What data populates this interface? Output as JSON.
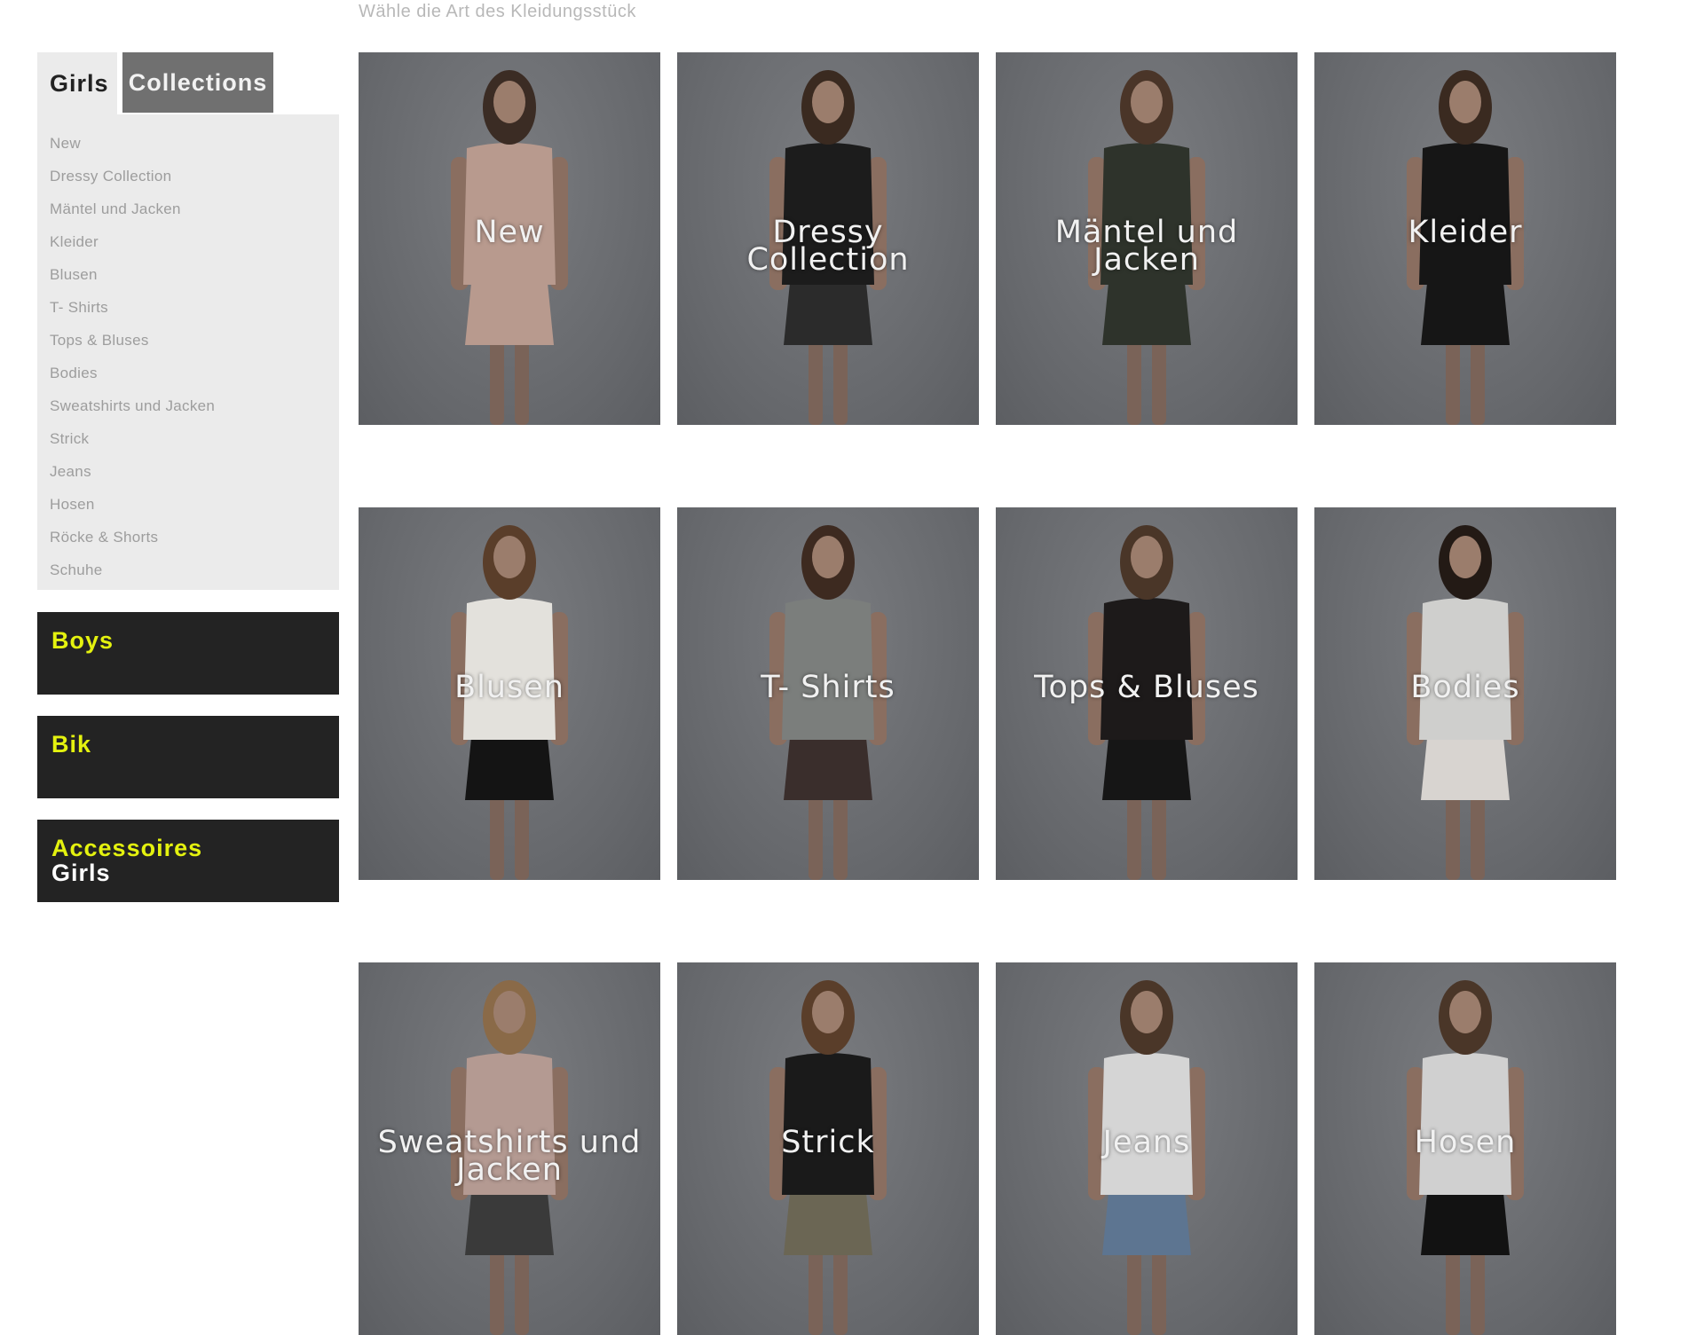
{
  "hint": "Wähle die Art des Kleidungsstück",
  "sidebar": {
    "tab_active": "Girls",
    "tab_other": "Collections",
    "categories": [
      "New",
      "Dressy Collection",
      "Mäntel und Jacken",
      "Kleider",
      "Blusen",
      "T- Shirts",
      "Tops & Bluses",
      "Bodies",
      "Sweatshirts und Jacken",
      "Strick",
      "Jeans",
      "Hosen",
      "Röcke & Shorts",
      "Schuhe"
    ],
    "blocks": [
      {
        "line1": "Boys",
        "line2": ""
      },
      {
        "line1": "Bik",
        "line2": ""
      },
      {
        "line1": "Accessoires",
        "line2": "Girls"
      }
    ]
  },
  "tiles": [
    {
      "label": "New",
      "top": "#b89a8e",
      "bottom": "#b89a8e",
      "hair": "#3b2c24"
    },
    {
      "label": "Dressy Collection",
      "top": "#1c1c1c",
      "bottom": "#2b2b2b",
      "hair": "#3a2a20"
    },
    {
      "label": "Mäntel und Jacken",
      "top": "#2e332b",
      "bottom": "#2e332b",
      "hair": "#4a3528"
    },
    {
      "label": "Kleider",
      "top": "#161616",
      "bottom": "#161616",
      "hair": "#3a2a20"
    },
    {
      "label": "Blusen",
      "top": "#e3e1dc",
      "bottom": "#141414",
      "hair": "#5a3e2a"
    },
    {
      "label": "T- Shirts",
      "top": "#7b7e7c",
      "bottom": "#3a2e2c",
      "hair": "#3d2a20"
    },
    {
      "label": "Tops & Bluses",
      "top": "#1d1a1a",
      "bottom": "#161616",
      "hair": "#4a3628"
    },
    {
      "label": "Bodies",
      "top": "#cfcfcd",
      "bottom": "#d8d4d0",
      "hair": "#231a15"
    },
    {
      "label": "Sweatshirts und Jacken",
      "top": "#b49a92",
      "bottom": "#3a3a3a",
      "hair": "#8a6a48"
    },
    {
      "label": "Strick",
      "top": "#1a1a1a",
      "bottom": "#6b6654",
      "hair": "#5a3e2a"
    },
    {
      "label": "Jeans",
      "top": "#d5d5d5",
      "bottom": "#5d7591",
      "hair": "#4a3628"
    },
    {
      "label": "Hosen",
      "top": "#d0d0d0",
      "bottom": "#121212",
      "hair": "#4a3628"
    }
  ]
}
